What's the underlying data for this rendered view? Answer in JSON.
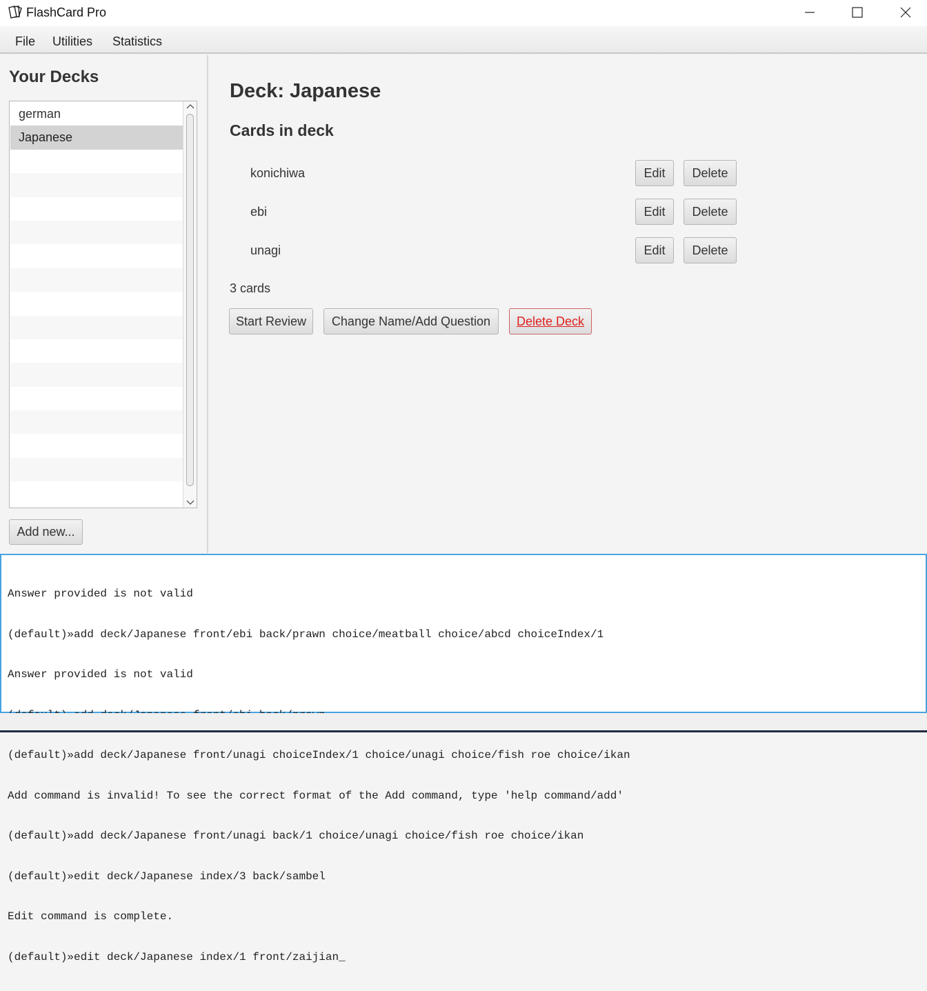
{
  "window": {
    "title": "FlashCard Pro",
    "icon": "cards-icon",
    "controls": [
      "minimize-icon",
      "maximize-icon",
      "close-icon"
    ]
  },
  "menu": {
    "items": [
      {
        "label": "File"
      },
      {
        "label": "Utilities"
      },
      {
        "label": "Statistics"
      }
    ]
  },
  "sidebar": {
    "title": "Your Decks",
    "decks": [
      {
        "label": "german",
        "selected": false
      },
      {
        "label": "Japanese",
        "selected": true
      }
    ],
    "add_label": "Add new..."
  },
  "main": {
    "deck_title": "Deck: Japanese",
    "cards_heading": "Cards in deck",
    "cards": [
      {
        "front": "konichiwa",
        "edit_label": "Edit",
        "delete_label": "Delete"
      },
      {
        "front": "ebi",
        "edit_label": "Edit",
        "delete_label": "Delete"
      },
      {
        "front": "unagi",
        "edit_label": "Edit",
        "delete_label": "Delete"
      }
    ],
    "card_count": "3 cards",
    "actions": {
      "start_review": "Start Review",
      "change_name": "Change Name/Add Question",
      "delete_deck": "Delete Deck"
    }
  },
  "console": {
    "lines": [
      "Answer provided is not valid",
      "(default)»add deck/Japanese front/ebi back/prawn choice/meatball choice/abcd choiceIndex/1",
      "Answer provided is not valid",
      "(default)»add deck/Japanese front/ebi back/prawn",
      "(default)»add deck/Japanese front/unagi choiceIndex/1 choice/unagi choice/fish roe choice/ikan",
      "Add command is invalid! To see the correct format of the Add command, type 'help command/add'",
      "(default)»add deck/Japanese front/unagi back/1 choice/unagi choice/fish roe choice/ikan",
      "(default)»edit deck/Japanese index/3 back/sambel",
      "Edit command is complete.",
      "(default)»edit deck/Japanese index/1 front/zaijian_"
    ]
  },
  "colors": {
    "console_border": "#45a3e0",
    "danger_text": "#e02020",
    "selected_row": "#d3d3d3"
  }
}
